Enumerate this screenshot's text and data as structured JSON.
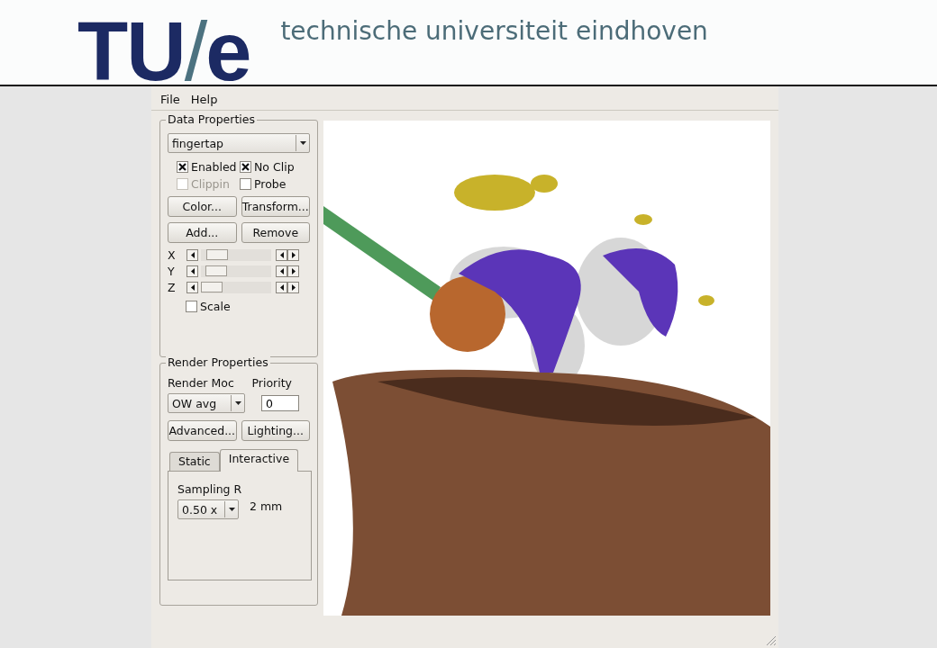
{
  "header": {
    "logo": {
      "left": "TU",
      "slash": "/",
      "right": "e"
    },
    "title": "technische universiteit eindhoven"
  },
  "menu": [
    "File",
    "Help"
  ],
  "data_properties": {
    "title": "Data Properties",
    "dataset": "fingertap",
    "checks": [
      {
        "label": "Enabled",
        "checked": true,
        "disabled": false
      },
      {
        "label": "No Clip",
        "checked": true,
        "disabled": false
      },
      {
        "label": "Clippin",
        "checked": false,
        "disabled": true
      },
      {
        "label": "Probe",
        "checked": false,
        "disabled": false
      }
    ],
    "buttons": [
      "Color...",
      "Transform...",
      "Add...",
      "Remove"
    ],
    "sliders": [
      {
        "label": "X",
        "level": 0.12
      },
      {
        "label": "Y",
        "level": 0.1
      },
      {
        "label": "Z",
        "level": 0.0
      }
    ],
    "scale": {
      "label": "Scale",
      "checked": false
    }
  },
  "render_properties": {
    "title": "Render Properties",
    "mode_label": "Render Moc",
    "priority_label": "Priority",
    "mode": "OW avg",
    "priority": "0",
    "buttons": [
      "Advanced...",
      "Lighting..."
    ],
    "tabs": [
      {
        "label": "Static",
        "selected": false
      },
      {
        "label": "Interactive",
        "selected": true
      }
    ],
    "sampling_label": "Sampling R",
    "sampling": "0.50 x",
    "sampling_value": "2 mm"
  },
  "viewport": {
    "kind": "picture"
  }
}
